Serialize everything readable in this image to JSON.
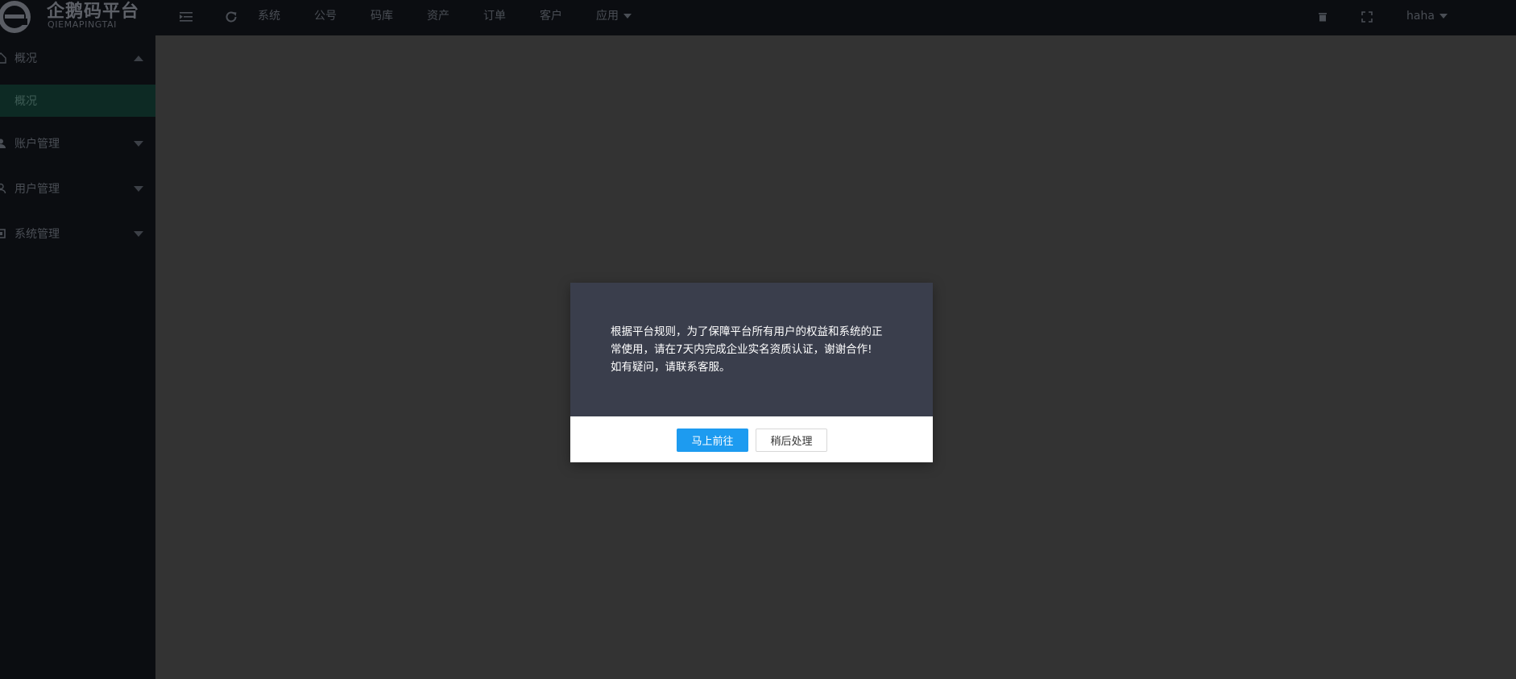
{
  "app": {
    "logo_cn": "企鹅码平台",
    "logo_en": "QIEMAPINGTAI"
  },
  "header": {
    "nav": [
      {
        "label": "系统"
      },
      {
        "label": "公号"
      },
      {
        "label": "码库"
      },
      {
        "label": "资产"
      },
      {
        "label": "订单"
      },
      {
        "label": "客户"
      },
      {
        "label": "应用"
      }
    ],
    "user": "haha"
  },
  "sidebar": {
    "items": [
      {
        "label": "概况",
        "expanded": true,
        "sub": [
          {
            "label": "概况",
            "active": true
          }
        ]
      },
      {
        "label": "账户管理",
        "expanded": false
      },
      {
        "label": "用户管理",
        "expanded": false
      },
      {
        "label": "系统管理",
        "expanded": false
      }
    ]
  },
  "modal": {
    "line1": "根据平台规则，为了保障平台所有用户的权益和系统的正",
    "line2": "常使用，请在7天内完成企业实名资质认证，谢谢合作!",
    "line3": "如有疑问，请联系客服。",
    "primary_label": "马上前往",
    "secondary_label": "稍后处理"
  },
  "colors": {
    "header_bg": "#0b0d11",
    "main_bg": "#333333",
    "modal_bg": "#3a3e4c",
    "primary": "#1d9bf0",
    "active_sub_bg": "#0d2a24"
  }
}
